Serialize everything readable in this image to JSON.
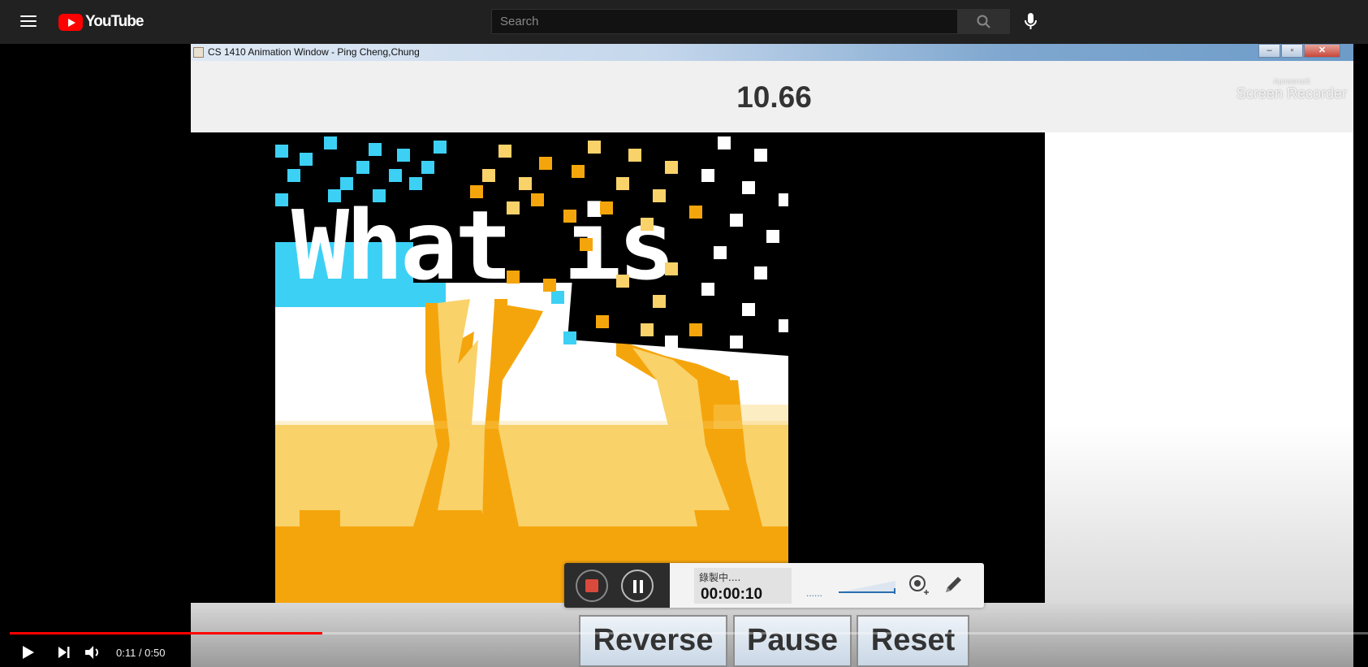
{
  "header": {
    "logo_text": "YouTube",
    "search_placeholder": "Search"
  },
  "window": {
    "title": "CS 1410 Animation Window - Ping Cheng,Chung",
    "minimize": "–",
    "restore": "▫",
    "close": "✕"
  },
  "animation": {
    "counter": "10.66",
    "canvas_text": "What is"
  },
  "watermark": {
    "small": "Apowersoft",
    "main": "Screen Recorder"
  },
  "buttons": {
    "reverse": "Reverse",
    "pause": "Pause",
    "reset": "Reset"
  },
  "recorder": {
    "status": "錄製中....",
    "time": "00:00:10",
    "dots": "......"
  },
  "player": {
    "time": "0:11 / 0:50",
    "played_fraction": 0.23
  },
  "colors": {
    "youtube_red": "#ff0000",
    "pixel_blue": "#3dd0f5",
    "pixel_gold": "#f5a50c",
    "pixel_light_gold": "#f9d26a"
  }
}
